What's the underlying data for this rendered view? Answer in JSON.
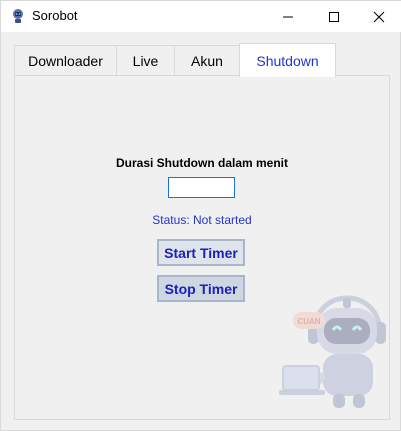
{
  "window": {
    "title": "Sorobot"
  },
  "tabs": [
    {
      "label": "Downloader",
      "active": false
    },
    {
      "label": "Live",
      "active": false
    },
    {
      "label": "Akun",
      "active": false
    },
    {
      "label": "Shutdown",
      "active": true
    }
  ],
  "shutdown": {
    "duration_label": "Durasi Shutdown dalam menit",
    "duration_value": "",
    "status_text": "Status: Not started",
    "start_label": "Start Timer",
    "stop_label": "Stop Timer"
  },
  "mascot": {
    "badge_text": "CUAN"
  },
  "colors": {
    "accent_text": "#2233cc",
    "input_border": "#1f6fd1"
  }
}
